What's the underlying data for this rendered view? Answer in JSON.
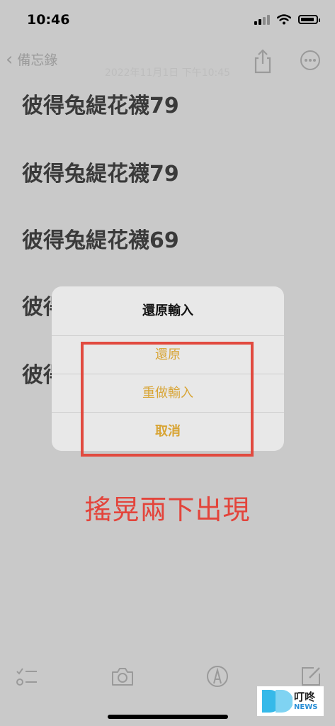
{
  "status_bar": {
    "time": "10:46"
  },
  "nav": {
    "back_label": "備忘錄",
    "date_text": "2022年11月1日 下午10:45"
  },
  "note": {
    "lines": [
      "彼得兔緹花襪79",
      "彼得兔緹花襪79",
      "彼得兔緹花襪69",
      "彼得",
      "彼得"
    ]
  },
  "dialog": {
    "title": "還原輸入",
    "buttons": [
      "還原",
      "重做輸入",
      "取消"
    ]
  },
  "annotation": {
    "text": "搖晃兩下出現"
  },
  "watermark": {
    "name_cn": "叮咚",
    "name_en": "NEWS"
  },
  "icons": [
    "chevron-left-icon",
    "share-icon",
    "more-icon",
    "checklist-icon",
    "camera-icon",
    "markup-icon",
    "compose-icon"
  ],
  "colors": {
    "accent": "#d8a434",
    "annotation": "#e3443b",
    "background": "#c9c9c9"
  }
}
